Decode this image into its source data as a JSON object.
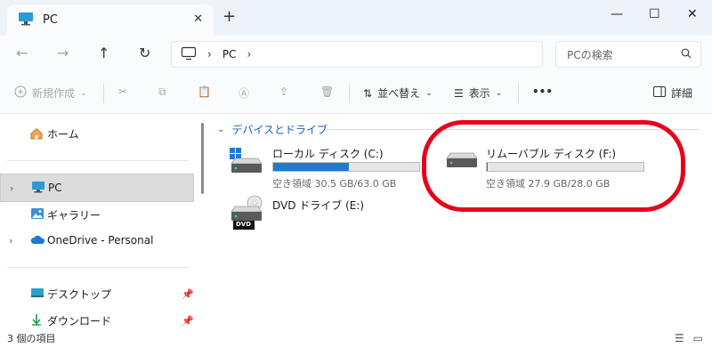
{
  "window": {
    "tab_title": "PC",
    "tab_close": "✕",
    "new_tab": "+",
    "minimize": "—",
    "maximize": "☐",
    "close": "✕"
  },
  "address_bar": {
    "path_root": "PC",
    "search_placeholder": "PCの検索"
  },
  "toolbar": {
    "new_label": "新規作成",
    "sort_label": "並べ替え",
    "view_label": "表示",
    "more_label": "•••",
    "details_label": "詳細"
  },
  "sidebar": {
    "home": "ホーム",
    "pc": "PC",
    "gallery": "ギャラリー",
    "onedrive": "OneDrive - Personal",
    "desktop": "デスクトップ",
    "downloads": "ダウンロード"
  },
  "main": {
    "group_title": "デバイスとドライブ",
    "drives": [
      {
        "name": "ローカル ディスク (C:)",
        "info": "空き領域 30.5 GB/63.0 GB",
        "used_fraction": 0.516
      },
      {
        "name": "リムーバブル ディスク (F:)",
        "info": "空き領域 27.9 GB/28.0 GB",
        "used_fraction": 0.004
      },
      {
        "name": "DVD ドライブ (E:)",
        "badge": "DVD"
      }
    ]
  },
  "status_bar": {
    "item_count": "3 個の項目"
  },
  "colors": {
    "accent": "#1f7ad4",
    "annotation": "#e8001c"
  }
}
